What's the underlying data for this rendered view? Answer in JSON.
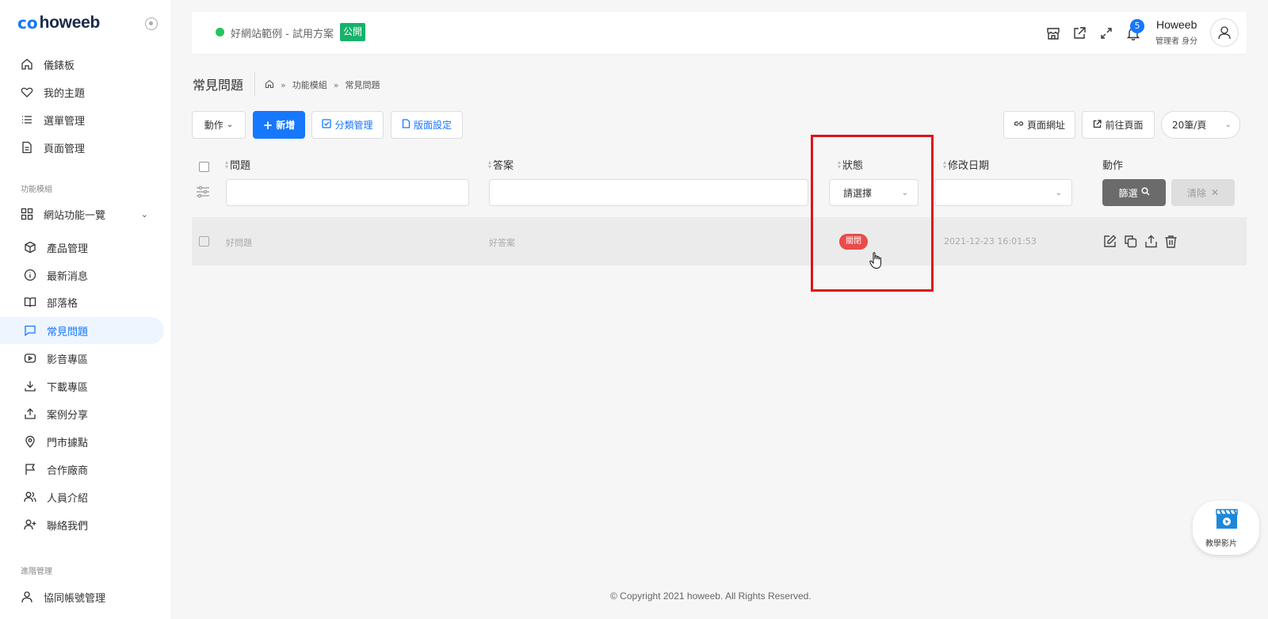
{
  "brand": {
    "logo_mark": "co",
    "name": "howeeb"
  },
  "sidebar": {
    "top_items": [
      {
        "label": "儀錶板",
        "icon": "home-icon"
      },
      {
        "label": "我的主題",
        "icon": "heart-icon"
      },
      {
        "label": "選單管理",
        "icon": "list-icon"
      },
      {
        "label": "頁面管理",
        "icon": "document-icon"
      }
    ],
    "section_modules": "功能模組",
    "group_label": "網站功能一覽",
    "module_items": [
      {
        "label": "產品管理",
        "icon": "box-icon"
      },
      {
        "label": "最新消息",
        "icon": "info-icon"
      },
      {
        "label": "部落格",
        "icon": "book-icon"
      },
      {
        "label": "常見問題",
        "icon": "message-icon"
      },
      {
        "label": "影音專區",
        "icon": "video-icon"
      },
      {
        "label": "下載專區",
        "icon": "download-icon"
      },
      {
        "label": "案例分享",
        "icon": "share-icon"
      },
      {
        "label": "門市據點",
        "icon": "location-icon"
      },
      {
        "label": "合作廠商",
        "icon": "flag-icon"
      },
      {
        "label": "人員介紹",
        "icon": "users-icon"
      },
      {
        "label": "聯絡我們",
        "icon": "user-plus-icon"
      }
    ],
    "section_advanced": "進階管理",
    "advanced_items": [
      {
        "label": "協同帳號管理",
        "icon": "user-icon"
      }
    ]
  },
  "header": {
    "site_name": "好網站範例 - 試用方案",
    "public_badge": "公開",
    "notification_count": "5",
    "user_name": "Howeeb",
    "user_role": "管理者 身分"
  },
  "page": {
    "title": "常見問題",
    "breadcrumb": [
      "功能模組",
      "常見問題"
    ]
  },
  "toolbar": {
    "actions_label": "動作",
    "add_label": "新增",
    "category_label": "分類管理",
    "layout_label": "版面設定",
    "page_url_label": "頁面網址",
    "goto_page_label": "前往頁面",
    "per_page": "20筆/頁"
  },
  "table": {
    "columns": {
      "question": "問題",
      "answer": "答案",
      "status": "狀態",
      "modified": "修改日期",
      "actions": "動作"
    },
    "status_placeholder": "請選擇",
    "filter_button": "篩選",
    "clear_button": "清除",
    "rows": [
      {
        "question": "好問題",
        "answer": "好答案",
        "status": "關閉",
        "modified": "2021-12-23 16:01:53"
      }
    ]
  },
  "footer": {
    "copyright": "© Copyright 2021 howeeb. All Rights Reserved."
  },
  "tutorial": {
    "label": "教學影片"
  },
  "colors": {
    "accent": "#1677ff",
    "public": "#18b26b",
    "status_closed": "#ea4b4b",
    "highlight": "#e0121a"
  }
}
